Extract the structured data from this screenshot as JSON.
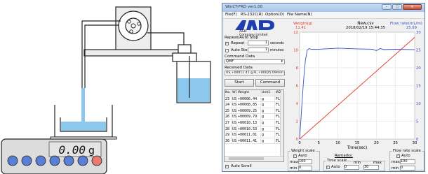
{
  "window": {
    "title": "WinCT-FRD ver1.00"
  },
  "menu": {
    "items": [
      "File(F)",
      "RS-232C(R)",
      "Option(O)",
      "File Name(N)"
    ]
  },
  "left": {
    "logo": "AND",
    "logo_caption": "A&D Company,Limited",
    "repeat_section": "Repeat/Auto Stop",
    "repeat_label": "Repeat",
    "repeat_value": "1",
    "repeat_unit": "seconds",
    "autostop_label": "Auto Stop",
    "autostop_value": "1",
    "autostop_unit": "minutes",
    "command_section": "Command Data",
    "command_value": "QMF",
    "received_section": "Received Data",
    "received_value": "US,+00011.41 g,FL,+00025.09mlm",
    "start_button": "Start",
    "command_button": "Command",
    "auto_scroll": "Auto Scroll"
  },
  "table": {
    "headers": [
      "No.",
      "W1",
      "Weight",
      "Unit1",
      "W2"
    ],
    "rows": [
      [
        "23",
        "US",
        "+00006.44",
        "g",
        "FL"
      ],
      [
        "24",
        "US",
        "+00008.85",
        "g",
        "FL"
      ],
      [
        "25",
        "US",
        "+00009.25",
        "g",
        "FL"
      ],
      [
        "26",
        "US",
        "+00009.79",
        "g",
        "FL"
      ],
      [
        "27",
        "US",
        "+00010.13",
        "g",
        "FL"
      ],
      [
        "28",
        "US",
        "+00010.53",
        "g",
        "FL"
      ],
      [
        "29",
        "US",
        "+00011.01",
        "g",
        "FL"
      ],
      [
        "30",
        "US",
        "+00011.41",
        "g",
        "FL"
      ]
    ]
  },
  "chart_data": {
    "type": "line",
    "title": "New.csv",
    "subtitle": "2018/02/19 15:44:35",
    "xlabel": "Time(sec)",
    "ylabel_left": "Weight(g)",
    "ylabel_left_value": "11.41",
    "ylabel_right": "Flow rate(mL/m)",
    "ylabel_right_value": "25.09",
    "xlim": [
      0,
      30
    ],
    "ylim_left": [
      0,
      12
    ],
    "ylim_right": [
      0,
      30
    ],
    "x_ticks": [
      "0",
      "5",
      "10",
      "15",
      "20",
      "25",
      "30"
    ],
    "y_left_ticks": [
      "0",
      "2",
      "4",
      "6",
      "8",
      "10",
      "12"
    ],
    "y_right_ticks": [
      "0",
      "5",
      "10",
      "15",
      "20",
      "25",
      "30"
    ],
    "series": [
      {
        "name": "Weight(g)",
        "axis": "left",
        "color": "#e03a2f",
        "x": [
          0,
          30
        ],
        "y": [
          0,
          11.41
        ]
      },
      {
        "name": "Flow rate(mL/m)",
        "axis": "right",
        "color": "#3a4fc4",
        "x": [
          0,
          0.5,
          1,
          1.5,
          2,
          2.5,
          3,
          5,
          10,
          15,
          19,
          20,
          21,
          22,
          25,
          30
        ],
        "y": [
          0,
          8,
          16,
          22,
          25,
          25.4,
          25.2,
          25.2,
          25.5,
          25.3,
          25.2,
          24.8,
          25.4,
          25.1,
          25.2,
          25.09
        ]
      }
    ]
  },
  "bottom": {
    "weight_scale": "Weight scale",
    "auto": "Auto",
    "max": "max",
    "min": "min",
    "weight_max": "100",
    "weight_min": "0",
    "remarks": "Remarks:",
    "time_scale": "Time scale",
    "time_min": "0",
    "time_max": "30",
    "flow_scale": "Flow rate scale",
    "flow_max": "100",
    "flow_min": "0"
  },
  "balance": {
    "display": "0.00",
    "unit": "g"
  },
  "colors": {
    "weight": "#e03a2f",
    "flow": "#3a4fc4",
    "water": "#8cc8ee",
    "balance_buttons": "#5b7fd6",
    "balance_red_button": "#e77a73"
  }
}
